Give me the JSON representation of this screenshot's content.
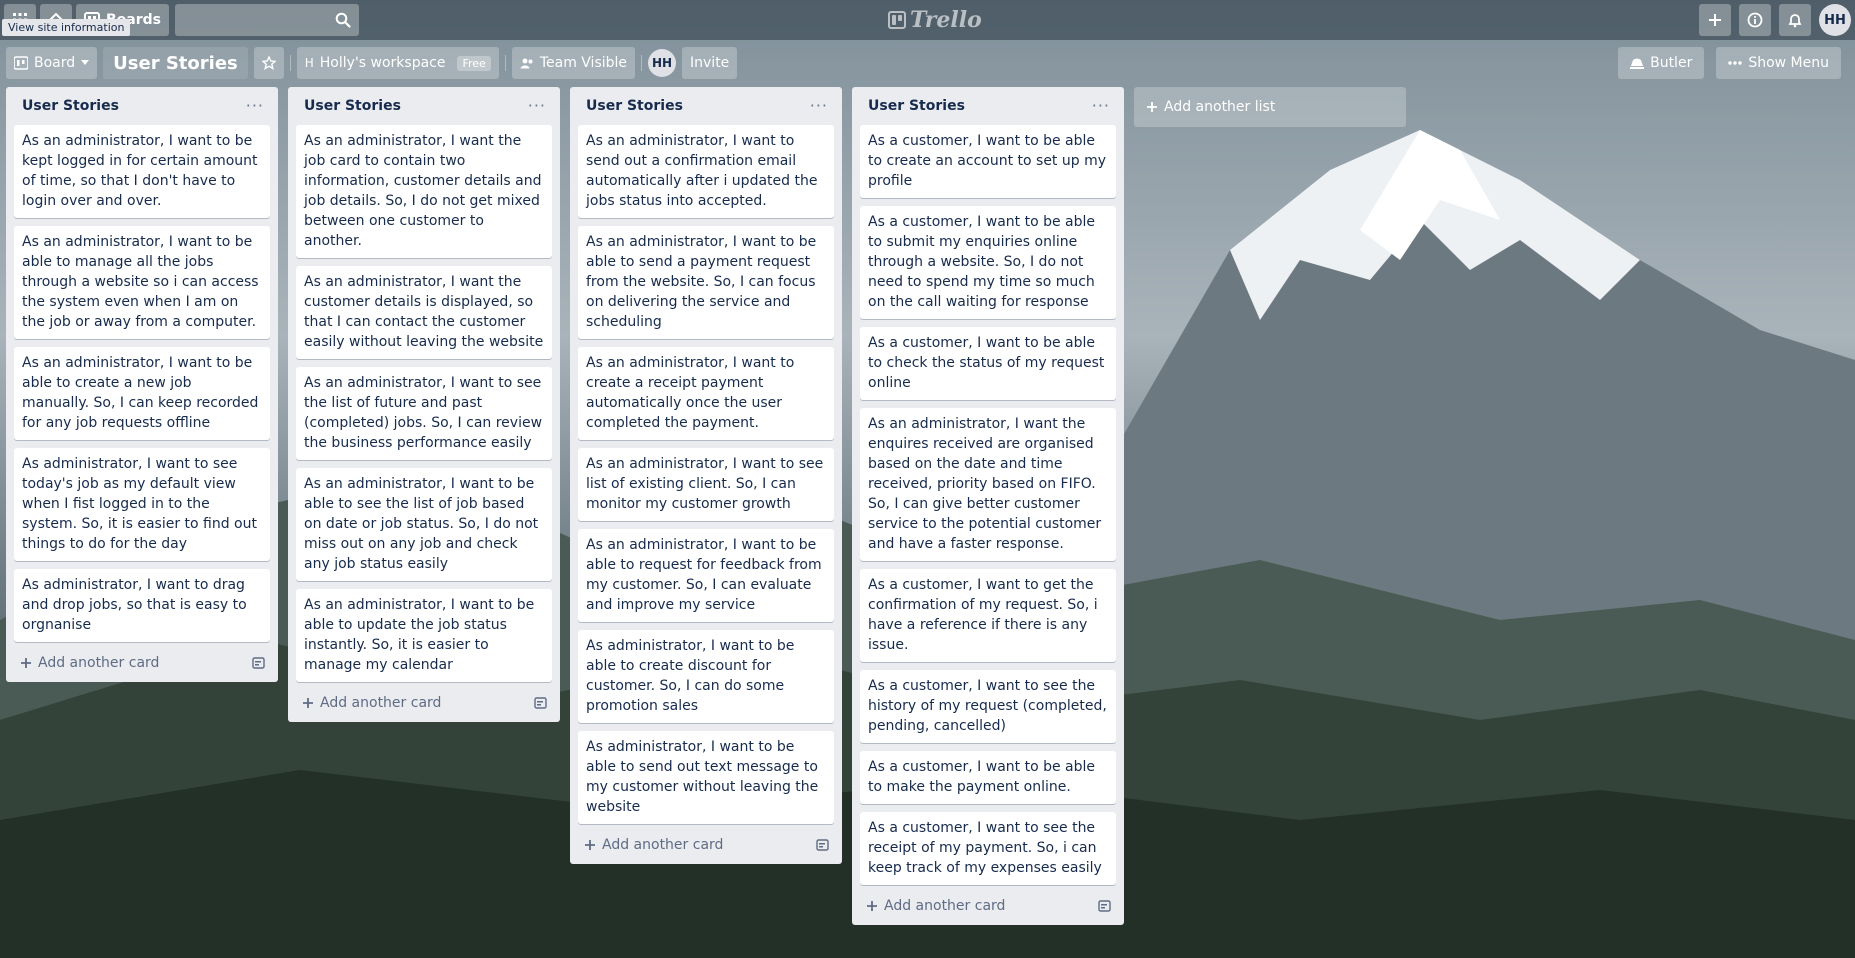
{
  "topbar": {
    "boards_label": "Boards",
    "search_placeholder": "",
    "logo_text": "Trello",
    "tooltip": "View site information",
    "avatar_initials": "HH"
  },
  "board_header": {
    "view_label": "Board",
    "board_title": "User Stories",
    "workspace_label": "Holly's workspace",
    "workspace_badge": "Free",
    "visibility_label": "Team Visible",
    "member_initials": "HH",
    "invite_label": "Invite",
    "butler_label": "Butler",
    "show_menu_label": "Show Menu"
  },
  "add_list_label": "Add another list",
  "lists": [
    {
      "title": "User Stories",
      "add_card_label": "Add another card",
      "cards": [
        "As an administrator, I want to be kept logged in for certain amount of time, so that I don't have to login over and over.",
        "As an administrator, I want to be able to manage all the jobs through a website so i can access the system even when I am on the job or away from a computer.",
        "As an administrator, I want to be able to create a new job manually. So, I can keep recorded for any job requests offline",
        "As administrator, I want to see today's job as my default view when I fist logged in to the system. So, it is easier to find out things to do for the day",
        "As administrator, I want to drag and drop jobs, so that is easy to orgnanise"
      ]
    },
    {
      "title": "User Stories",
      "add_card_label": "Add another card",
      "cards": [
        "As an administrator, I want the job card to contain two information, customer details and job details. So, I do not get mixed between one customer to another.",
        "As an administrator, I want the customer details is displayed, so that I can contact the customer easily without leaving the website",
        "As an administrator, I want to see the list of future and past (completed) jobs. So, I can review the business performance easily",
        "As an administrator, I want to be able to see the list of job based on date or job status. So, I do not miss out on any job and check any job status easily",
        "As an administrator, I want to be able to update the job status instantly. So, it is easier to manage my calendar"
      ]
    },
    {
      "title": "User Stories",
      "add_card_label": "Add another card",
      "cards": [
        "As an administrator, I want to send out a confirmation email automatically after i updated the jobs status into accepted.",
        "As an administrator, I want to be able to send a payment request from the website. So, I can focus on delivering the service and scheduling",
        "As an administrator, I want to create a receipt payment automatically once the user completed the payment.",
        "As an administrator, I want to see list of existing client. So, I can monitor my customer growth",
        "As an administrator, I want to be able to request for feedback from my customer. So, I can evaluate and improve my service",
        "As administrator, I want to be able to create discount for customer. So, I can do some promotion sales",
        "As administrator, I want to be able to send out text message to my customer without leaving the website"
      ]
    },
    {
      "title": "User Stories",
      "add_card_label": "Add another card",
      "cards": [
        "As a customer, I want to be able to create an account to set up my profile",
        "As a customer, I want to be able to submit my enquiries online through a website. So, I do not need to spend my time so much on the call waiting for response",
        "As a customer, I want to be able to check the status of my request online",
        "As an administrator, I want the enquires received are organised based on the date and time received, priority based on FIFO. So, I can give better customer service to the potential customer and have a faster response.",
        "As a customer, I want to get the confirmation of my request. So, i have a reference if there is any issue.",
        "As a customer, I want to see the history of my request (completed, pending, cancelled)",
        "As a customer, I want to be able to make the payment online.",
        "As a customer, I want to see the receipt of my payment. So, i can keep track of my expenses easily"
      ]
    }
  ],
  "icons": {
    "apps": "apps-icon",
    "home": "home-icon",
    "boards": "boards-icon",
    "search": "search-icon",
    "add": "plus-icon",
    "info": "info-icon",
    "notifications": "bell-icon",
    "star": "star-icon",
    "list_menu": "more-horizontal-icon",
    "card_template": "card-template-icon"
  },
  "colors": {
    "list_bg": "#ebecf0",
    "card_bg": "#ffffff",
    "text": "#172b4d",
    "muted": "#5e6c84"
  }
}
